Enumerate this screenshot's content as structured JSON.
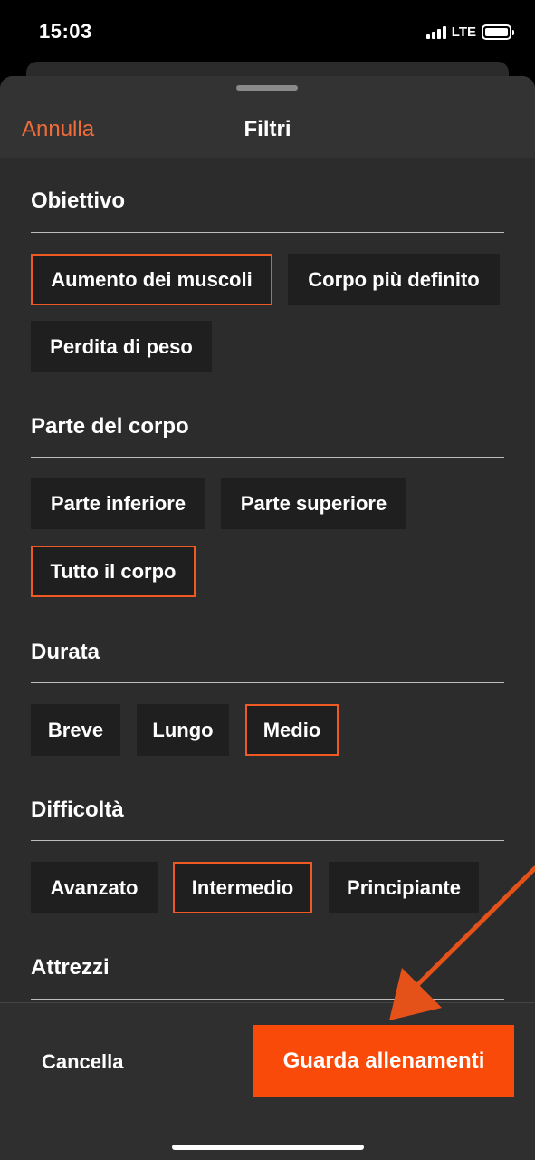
{
  "status_bar": {
    "time": "15:03",
    "network": "LTE"
  },
  "header": {
    "cancel_label": "Annulla",
    "title": "Filtri"
  },
  "sections": [
    {
      "title": "Obiettivo",
      "chips": [
        {
          "label": "Aumento dei muscoli",
          "selected": true
        },
        {
          "label": "Corpo più definito",
          "selected": false
        },
        {
          "label": "Perdita di peso",
          "selected": false
        }
      ]
    },
    {
      "title": "Parte del corpo",
      "chips": [
        {
          "label": "Parte inferiore",
          "selected": false
        },
        {
          "label": "Parte superiore",
          "selected": false
        },
        {
          "label": "Tutto il corpo",
          "selected": true
        }
      ]
    },
    {
      "title": "Durata",
      "chips": [
        {
          "label": "Breve",
          "selected": false
        },
        {
          "label": "Lungo",
          "selected": false
        },
        {
          "label": "Medio",
          "selected": true
        }
      ]
    },
    {
      "title": "Difficoltà",
      "chips": [
        {
          "label": "Avanzato",
          "selected": false
        },
        {
          "label": "Intermedio",
          "selected": true
        },
        {
          "label": "Principiante",
          "selected": false
        }
      ]
    },
    {
      "title": "Attrezzi",
      "chips": []
    }
  ],
  "footer": {
    "clear_label": "Cancella",
    "primary_label": "Guarda allenamenti"
  },
  "colors": {
    "accent": "#ef6c3a",
    "primary_button": "#fa4a0a",
    "selected_border": "#ef5a24",
    "annotation_arrow": "#e4521a"
  }
}
